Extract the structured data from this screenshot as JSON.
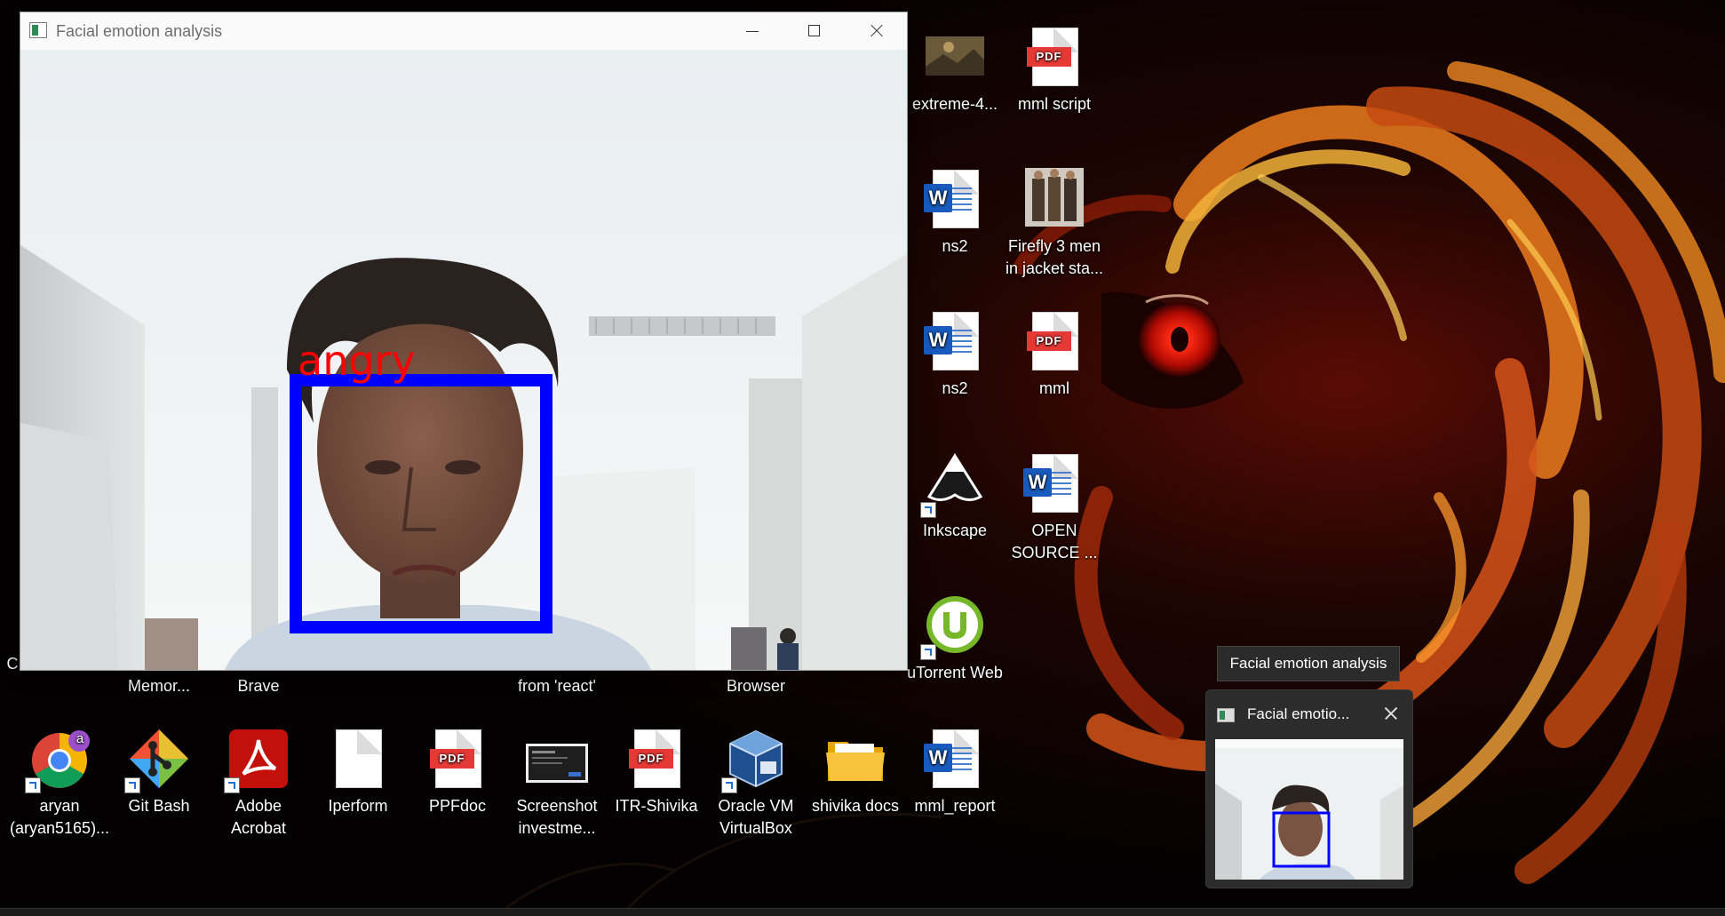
{
  "window": {
    "title": "Facial emotion analysis",
    "detection_label": "angry",
    "box_color": "#0000ff",
    "label_color": "#ff0000"
  },
  "desktop": {
    "right_column": [
      {
        "id": "extreme",
        "label": "extreme-4...",
        "icon": "image-thumbnail-icon"
      },
      {
        "id": "mml-script",
        "label": "mml script",
        "icon": "pdf-file-icon"
      },
      {
        "id": "ns2-a",
        "label": "ns2",
        "icon": "word-document-icon"
      },
      {
        "id": "firefly",
        "label": "Firefly 3 men\nin jacket sta...",
        "line1": "Firefly 3 men",
        "line2": "in jacket sta...",
        "icon": "image-thumbnail-icon"
      },
      {
        "id": "ns2-b",
        "label": "ns2",
        "icon": "word-document-icon"
      },
      {
        "id": "mml",
        "label": "mml",
        "icon": "pdf-file-icon"
      },
      {
        "id": "inkscape",
        "label": "Inkscape",
        "icon": "inkscape-icon"
      },
      {
        "id": "open-source",
        "line1": "OPEN",
        "line2": "SOURCE ...",
        "icon": "word-document-icon"
      },
      {
        "id": "utorrent",
        "label": "uTorrent Web",
        "icon": "utorrent-icon"
      }
    ],
    "partial_labels": [
      "C",
      "Memor...",
      "Brave",
      "from 'react'",
      "Browser"
    ],
    "bottom_row": [
      {
        "line1": "aryan",
        "line2": "(aryan5165)...",
        "icon": "chrome-profile-icon"
      },
      {
        "line1": "Git Bash",
        "line2": "",
        "icon": "git-bash-icon"
      },
      {
        "line1": "Adobe",
        "line2": "Acrobat",
        "icon": "adobe-acrobat-icon"
      },
      {
        "line1": "Iperform",
        "line2": "",
        "icon": "blank-file-icon"
      },
      {
        "line1": "PPFdoc",
        "line2": "",
        "icon": "pdf-file-icon"
      },
      {
        "line1": "Screenshot",
        "line2": "investme...",
        "icon": "screenshot-thumbnail-icon"
      },
      {
        "line1": "ITR-Shivika",
        "line2": "",
        "icon": "pdf-file-icon"
      },
      {
        "line1": "Oracle VM",
        "line2": "VirtualBox",
        "icon": "virtualbox-icon"
      },
      {
        "line1": "shivika docs",
        "line2": "",
        "icon": "folder-icon"
      },
      {
        "line1": "mml_report",
        "line2": "",
        "icon": "word-document-icon"
      }
    ],
    "chrome_badge": "a"
  },
  "taskbar_preview": {
    "tooltip": "Facial emotion analysis",
    "title": "Facial emotio..."
  },
  "icons": {
    "pdf_text": "PDF",
    "word_letter": "W"
  }
}
